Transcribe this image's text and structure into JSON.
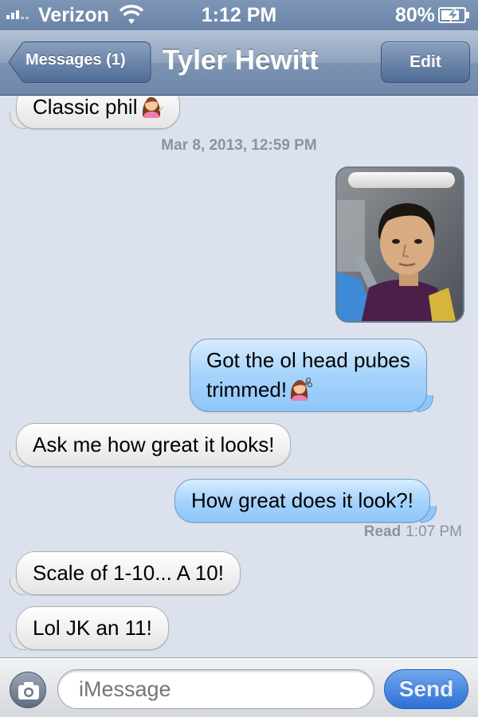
{
  "status_bar": {
    "carrier": "Verizon",
    "time": "1:12 PM",
    "battery": "80%",
    "icons": [
      "signal-icon",
      "wifi-icon",
      "battery-charging-icon"
    ]
  },
  "nav": {
    "back_label": "Messages (1)",
    "title": "Tyler Hewitt",
    "edit_label": "Edit"
  },
  "messages": [
    {
      "direction": "incoming",
      "text": "Classic phil",
      "emoji": "woman-tipping-hand-emoji"
    },
    {
      "type": "timestamp",
      "text": "Mar 8, 2013, 12:59 PM"
    },
    {
      "direction": "outgoing",
      "type": "photo",
      "content": "selfie-photo"
    },
    {
      "direction": "outgoing",
      "lines": [
        "Got the ol head pubes",
        "trimmed!"
      ],
      "emoji": "haircut-emoji"
    },
    {
      "direction": "incoming",
      "text": "Ask me how great it looks!"
    },
    {
      "direction": "outgoing",
      "text": "How great does it look?!"
    },
    {
      "type": "read_receipt",
      "label": "Read",
      "time": "1:07 PM"
    },
    {
      "direction": "incoming",
      "text": "Scale of 1-10... A 10!"
    },
    {
      "direction": "incoming",
      "text": "Lol JK an 11!"
    }
  ],
  "input_bar": {
    "placeholder": "iMessage",
    "send_label": "Send",
    "camera_icon": "camera-icon"
  },
  "colors": {
    "background": "#dbe2ed",
    "nav_bar": "#7c93b2",
    "outgoing_bubble": "#8ec7fb",
    "incoming_bubble": "#ffffff",
    "send_button": "#2e6fd6"
  }
}
